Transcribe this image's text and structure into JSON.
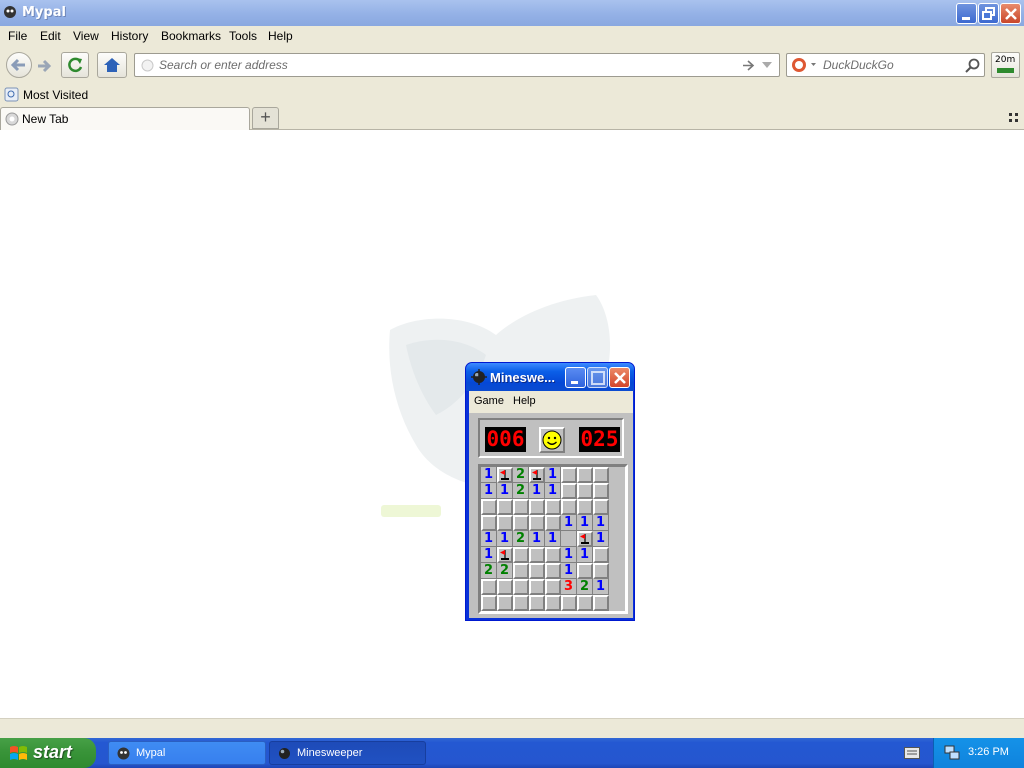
{
  "window": {
    "title": "Mypal"
  },
  "menubar": {
    "items": [
      "File",
      "Edit",
      "View",
      "History",
      "Bookmarks",
      "Tools",
      "Help"
    ]
  },
  "navbar": {
    "address_placeholder": "Search or enter address",
    "search_placeholder": "DuckDuckGo",
    "zoom_label": "20m"
  },
  "bookmarks": {
    "most_visited": "Most Visited"
  },
  "tabs": [
    {
      "label": "New Tab"
    }
  ],
  "minesweeper": {
    "title": "Mineswe...",
    "menu": [
      "Game",
      "Help"
    ],
    "mines_left": "006",
    "time": "025",
    "board": [
      "1F2F1???",
      "11211???",
      "????????",
      "?????111",
      "11211 F1",
      "1F???11?",
      "22???1??",
      "?????321",
      "????????"
    ]
  },
  "taskbar": {
    "start_label": "start",
    "tasks": [
      {
        "label": "Mypal"
      },
      {
        "label": "Minesweeper"
      }
    ],
    "clock": "3:26 PM"
  },
  "colors": {
    "titlebar": "#94b1e6",
    "taskbar": "#2556cf",
    "start": "#3a953a",
    "lcd_red": "#ff0000"
  }
}
